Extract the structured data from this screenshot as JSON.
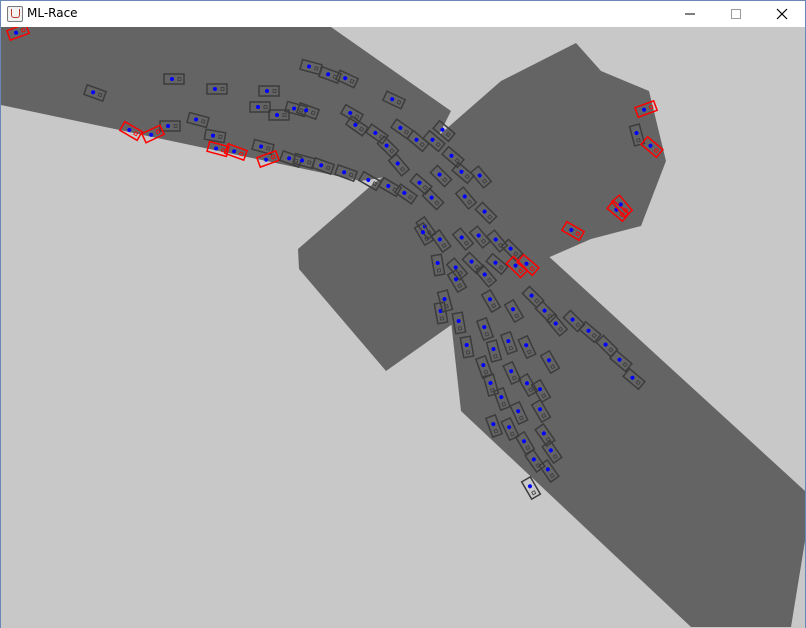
{
  "window": {
    "title": "ML-Race",
    "app_icon": "java-cup-icon",
    "controls": [
      "minimize-icon",
      "maximize-icon",
      "close-icon"
    ]
  },
  "scene": {
    "colors": {
      "background": "#c8c8c8",
      "track": "#646464",
      "car_outline": "#3c3c3c",
      "crashed_car_outline": "#ff0000",
      "car_marker": "#0000ff"
    }
  }
}
